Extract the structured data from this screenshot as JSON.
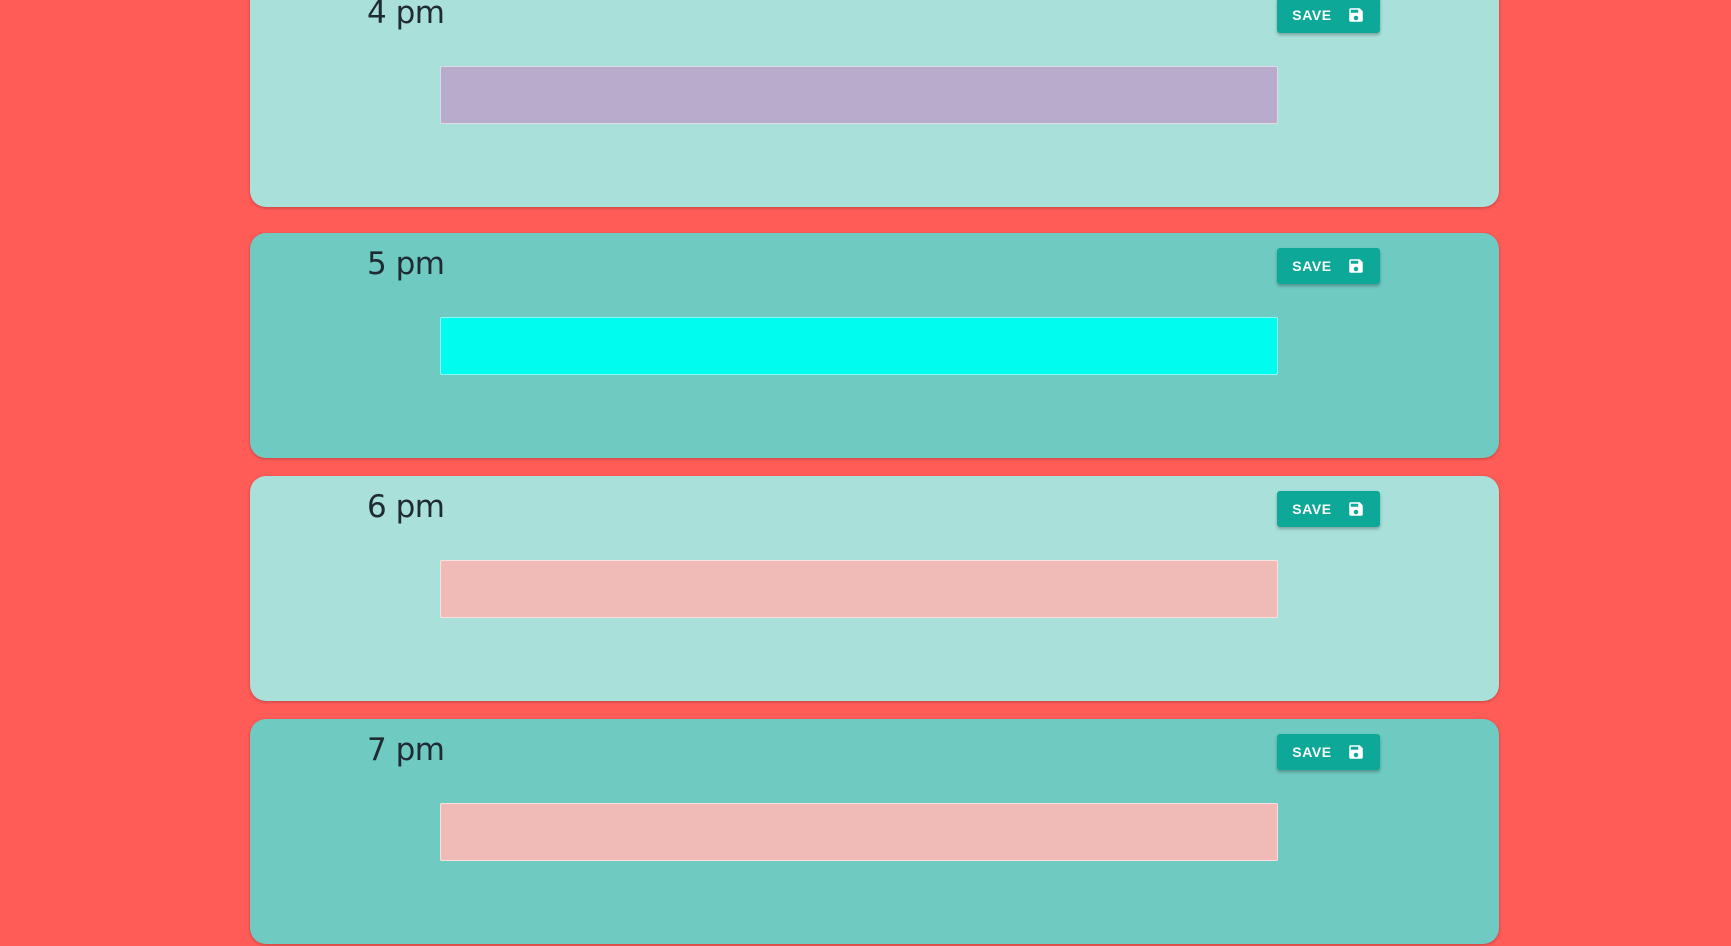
{
  "hours": [
    {
      "label": "4 pm",
      "note": "",
      "save_label": "SAVE",
      "icon": "floppy-disk-icon",
      "card_color": "#aae0da",
      "input_color": "#b9abcb"
    },
    {
      "label": "5 pm",
      "note": "",
      "save_label": "SAVE",
      "icon": "floppy-disk-icon",
      "card_color": "#6fcac2",
      "input_color": "#00fcef"
    },
    {
      "label": "6 pm",
      "note": "",
      "save_label": "SAVE",
      "icon": "floppy-disk-icon",
      "card_color": "#aae0da",
      "input_color": "#f0bab6"
    },
    {
      "label": "7 pm",
      "note": "",
      "save_label": "SAVE",
      "icon": "floppy-disk-icon",
      "card_color": "#6fcac2",
      "input_color": "#f0bab6"
    }
  ],
  "colors": {
    "page_background": "#ff5c58",
    "button_background": "#0da898",
    "button_text": "#ffffff"
  }
}
